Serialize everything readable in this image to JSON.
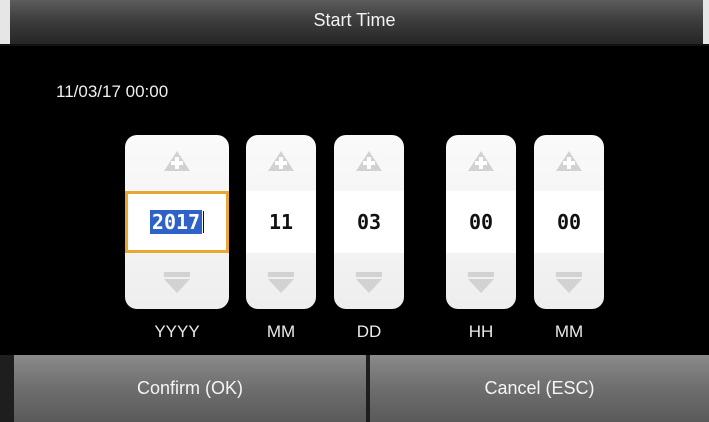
{
  "title": "Start Time",
  "preview": "11/03/17 00:00",
  "spinners": [
    {
      "value": "2017",
      "label": "YYYY"
    },
    {
      "value": "11",
      "label": "MM"
    },
    {
      "value": "03",
      "label": "DD"
    },
    {
      "value": "00",
      "label": "HH"
    },
    {
      "value": "00",
      "label": "MM"
    }
  ],
  "buttons": {
    "confirm": "Confirm (OK)",
    "cancel": "Cancel (ESC)"
  },
  "colors": {
    "background": "#000000",
    "focus_border": "#e8a633",
    "selection": "#2f62c9"
  },
  "icons": {
    "increment": "plus-up-arrow-icon",
    "decrement": "down-triangle-icon"
  }
}
